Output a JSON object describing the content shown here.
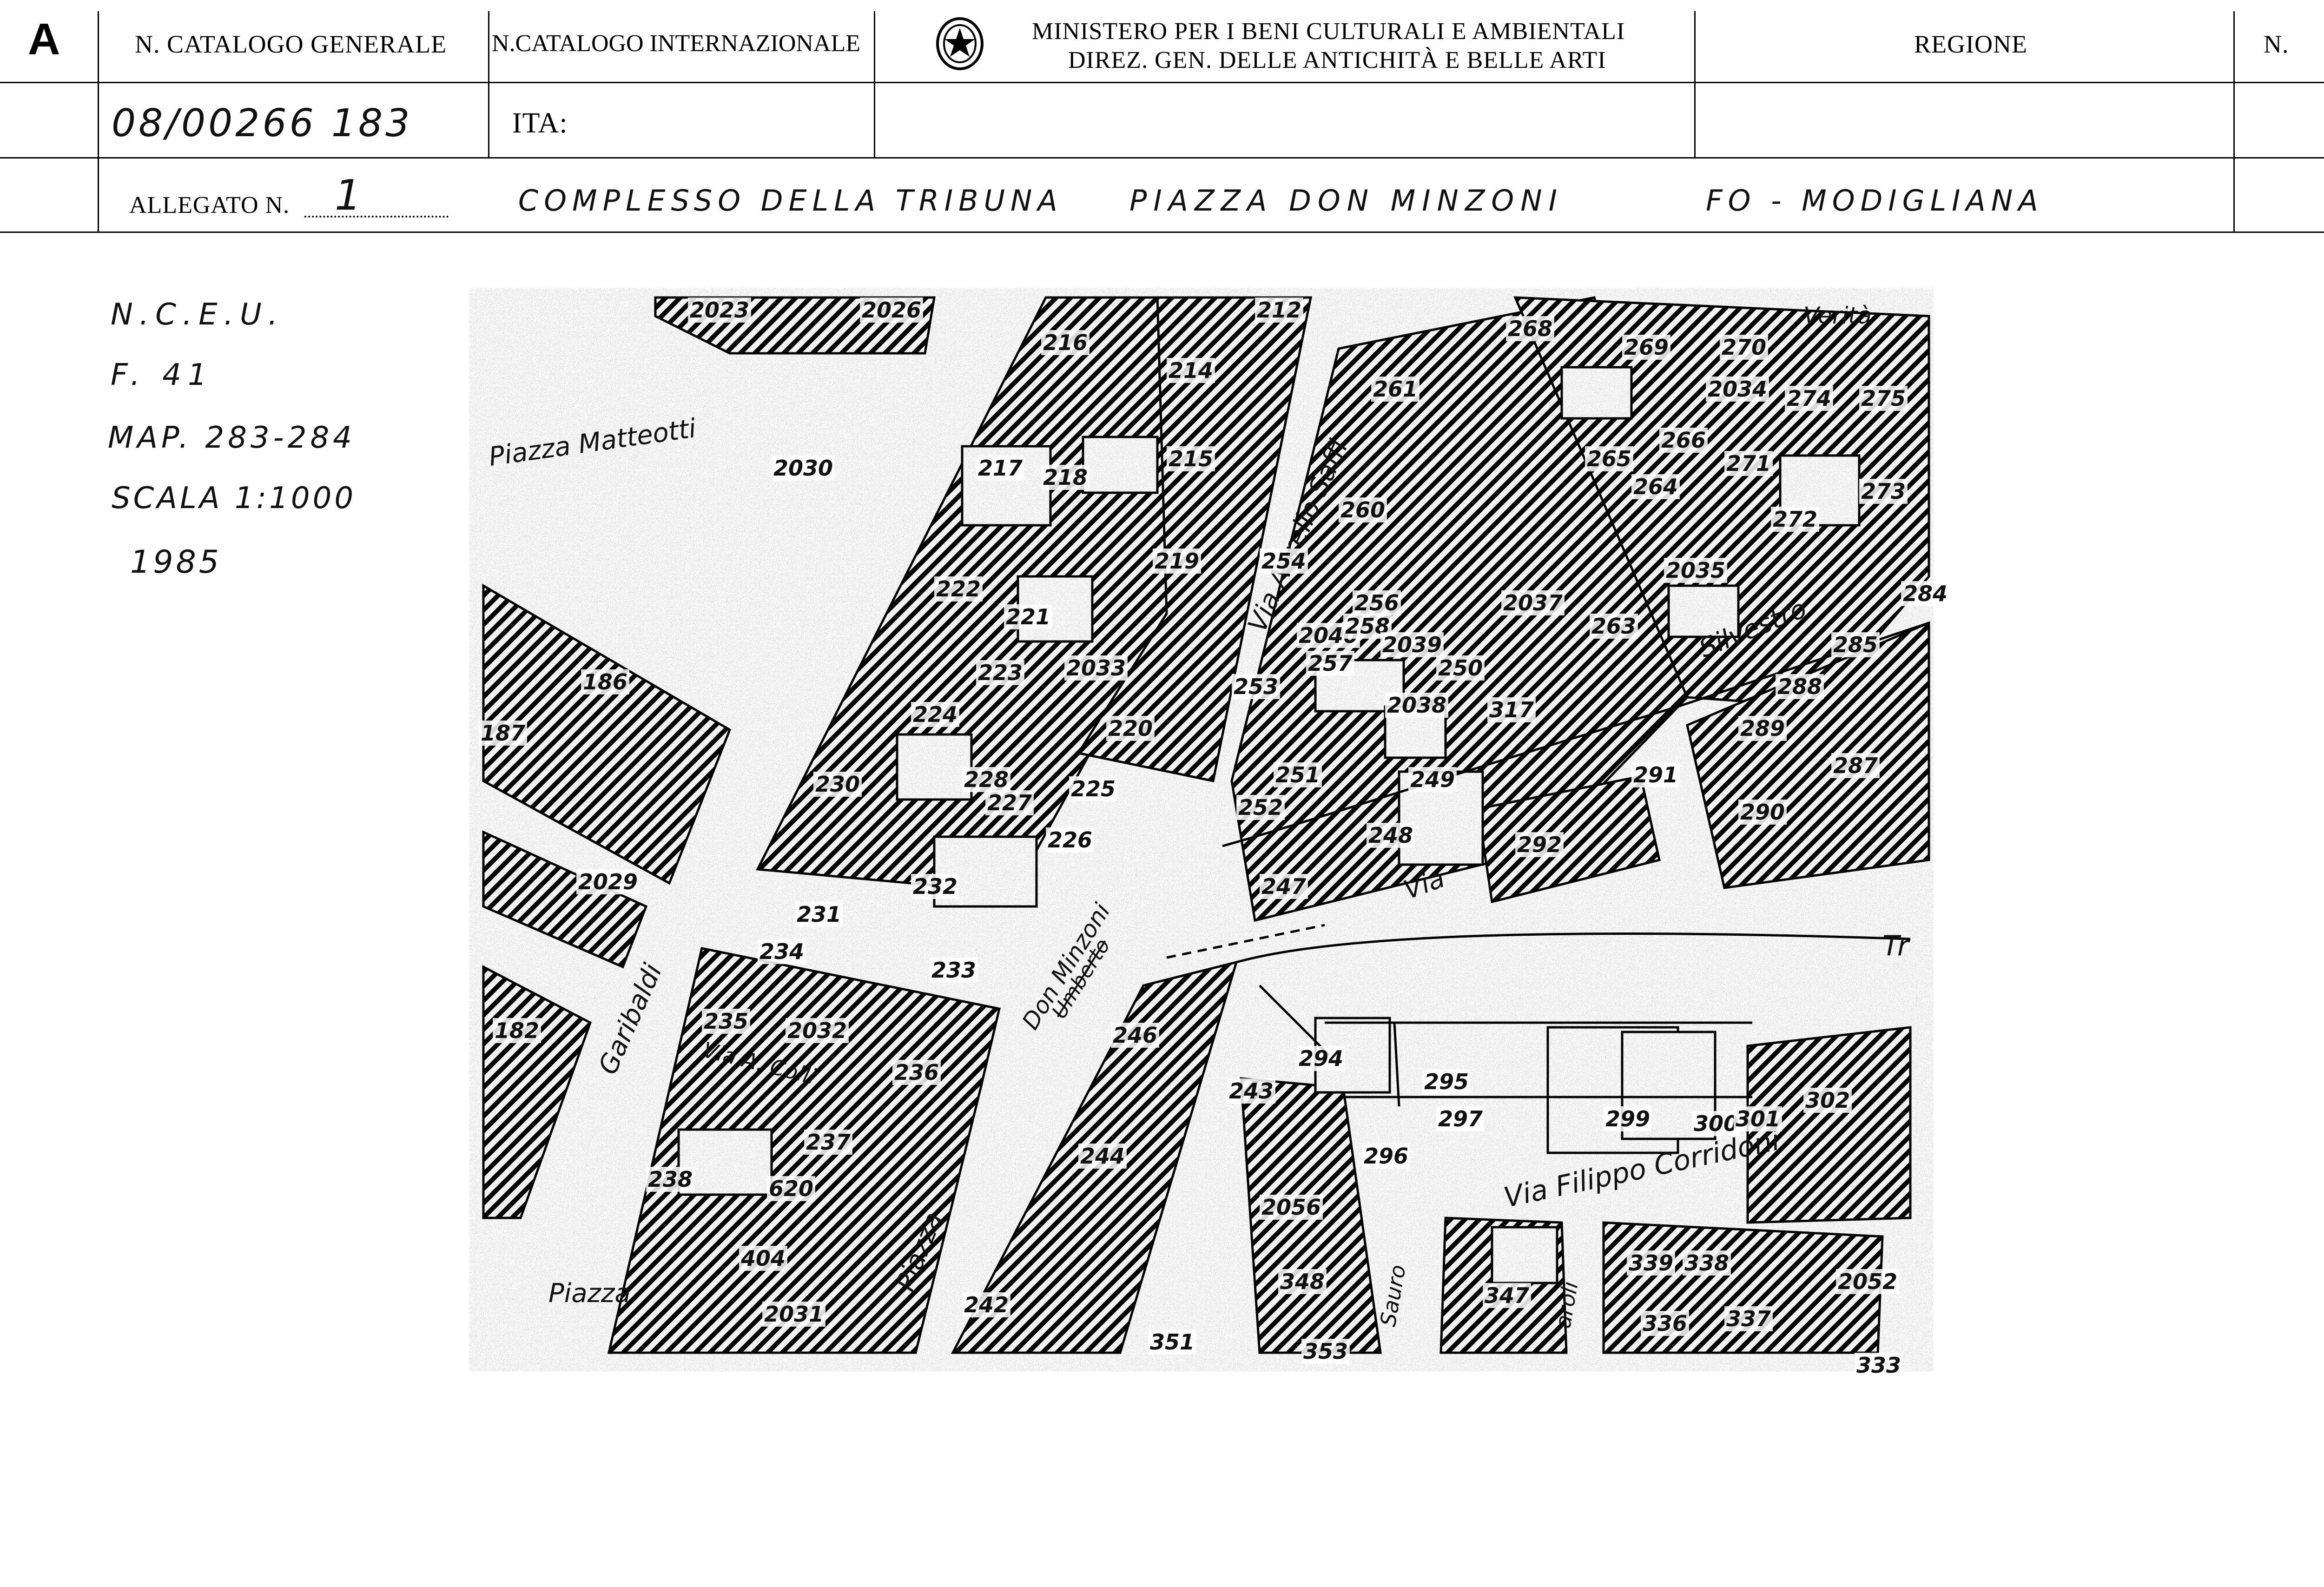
{
  "form": {
    "letter": "A",
    "col_catalogo_generale": "N. CATALOGO GENERALE",
    "col_catalogo_internazionale": "N.CATALOGO INTERNAZIONALE",
    "ministry_line1": "MINISTERO PER I BENI CULTURALI E AMBIENTALI",
    "ministry_line2": "DIREZ. GEN. DELLE ANTICHITÀ E BELLE ARTI",
    "col_regione": "REGIONE",
    "col_n": "N.",
    "catalogo_generale_value": "08/00266 183",
    "ita_label": "ITA:",
    "allegato_label": "ALLEGATO N.",
    "allegato_value": "1",
    "subject": "COMPLESSO DELLA TRIBUNA",
    "location": "PIAZZA DON MINZONI",
    "place": "FO - MODIGLIANA"
  },
  "notes": {
    "line1": "N.C.E.U.",
    "line2": "F. 41",
    "line3": "MAP. 283-284",
    "line4": "SCALA 1:1000",
    "line5": "1985"
  },
  "map": {
    "streets": {
      "piazza_matteotti": "Piazza Matteotti",
      "via_aurelio": "Via Aurelio Saffi",
      "silvestro": "Silvestro",
      "via": "Via",
      "garibaldi": "Garibaldi",
      "don_minzoni": "Don Minzoni",
      "piazza": "Piazza",
      "via_a_colli": "Via A. Colli",
      "via_filippo_corridoni": "Via Filippo Corridoni",
      "sauro": "Sauro",
      "garoli": "aroli",
      "piazza_bottom": "Piazza",
      "tr": "Tr",
      "verita": "Verità",
      "struck": "Umberto"
    },
    "parcels": [
      {
        "n": "2023"
      },
      {
        "n": "2026"
      },
      {
        "n": "212"
      },
      {
        "n": "216"
      },
      {
        "n": "214"
      },
      {
        "n": "268"
      },
      {
        "n": "269"
      },
      {
        "n": "270"
      },
      {
        "n": "2034"
      },
      {
        "n": "274"
      },
      {
        "n": "275"
      },
      {
        "n": "261"
      },
      {
        "n": "215"
      },
      {
        "n": "265"
      },
      {
        "n": "264"
      },
      {
        "n": "2030"
      },
      {
        "n": "217"
      },
      {
        "n": "218"
      },
      {
        "n": "266"
      },
      {
        "n": "271"
      },
      {
        "n": "273"
      },
      {
        "n": "260"
      },
      {
        "n": "272"
      },
      {
        "n": "219"
      },
      {
        "n": "2035"
      },
      {
        "n": "254"
      },
      {
        "n": "222"
      },
      {
        "n": "221"
      },
      {
        "n": "256"
      },
      {
        "n": "2037"
      },
      {
        "n": "284"
      },
      {
        "n": "2040"
      },
      {
        "n": "258"
      },
      {
        "n": "2039"
      },
      {
        "n": "263"
      },
      {
        "n": "285"
      },
      {
        "n": "257"
      },
      {
        "n": "250"
      },
      {
        "n": "186"
      },
      {
        "n": "223"
      },
      {
        "n": "2033"
      },
      {
        "n": "253"
      },
      {
        "n": "2038"
      },
      {
        "n": "288"
      },
      {
        "n": "317"
      },
      {
        "n": "224"
      },
      {
        "n": "220"
      },
      {
        "n": "289"
      },
      {
        "n": "187"
      },
      {
        "n": "251"
      },
      {
        "n": "249"
      },
      {
        "n": "287"
      },
      {
        "n": "291"
      },
      {
        "n": "230"
      },
      {
        "n": "228"
      },
      {
        "n": "225"
      },
      {
        "n": "227"
      },
      {
        "n": "252"
      },
      {
        "n": "290"
      },
      {
        "n": "226"
      },
      {
        "n": "248"
      },
      {
        "n": "292"
      },
      {
        "n": "2029"
      },
      {
        "n": "232"
      },
      {
        "n": "247"
      },
      {
        "n": "231"
      },
      {
        "n": "234"
      },
      {
        "n": "233"
      },
      {
        "n": "182"
      },
      {
        "n": "235"
      },
      {
        "n": "2032"
      },
      {
        "n": "246"
      },
      {
        "n": "294"
      },
      {
        "n": "236"
      },
      {
        "n": "295"
      },
      {
        "n": "302"
      },
      {
        "n": "243"
      },
      {
        "n": "297"
      },
      {
        "n": "299"
      },
      {
        "n": "300"
      },
      {
        "n": "301"
      },
      {
        "n": "237"
      },
      {
        "n": "244"
      },
      {
        "n": "296"
      },
      {
        "n": "238"
      },
      {
        "n": "620"
      },
      {
        "n": "2056"
      },
      {
        "n": "404"
      },
      {
        "n": "339"
      },
      {
        "n": "338"
      },
      {
        "n": "2052"
      },
      {
        "n": "348"
      },
      {
        "n": "347"
      },
      {
        "n": "242"
      },
      {
        "n": "2031"
      },
      {
        "n": "336"
      },
      {
        "n": "337"
      },
      {
        "n": "351"
      },
      {
        "n": "353"
      },
      {
        "n": "333"
      }
    ]
  }
}
